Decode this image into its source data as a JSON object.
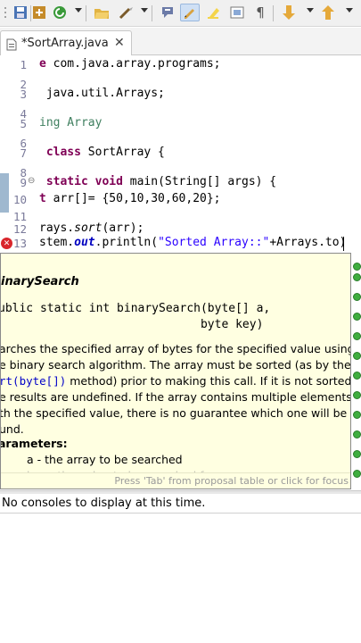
{
  "toolbar": {
    "icons": [
      "save-icon",
      "skip-breakpoints-icon",
      "debug-icon",
      "open-folder-icon",
      "wand-icon",
      "comment-icon",
      "edit-toggle-icon",
      "highlight-icon",
      "show-whitespace-icon",
      "next-annotation-icon",
      "previous-annotation-icon"
    ]
  },
  "editor_tab": {
    "label": "*SortArray.java",
    "close": "✕"
  },
  "code_lines": [
    {
      "num": "1",
      "text": "e com.java.array.programs;"
    },
    {
      "num": "2",
      "text": ""
    },
    {
      "num": "3",
      "text": " java.util.Arrays;"
    },
    {
      "num": "4",
      "text": ""
    },
    {
      "num": "5",
      "text": "ing Array"
    },
    {
      "num": "6",
      "text": ""
    },
    {
      "num": "7",
      "text": " class SortArray {"
    },
    {
      "num": "8",
      "text": ""
    },
    {
      "num": "9",
      "text": " static void main(String[] args) {"
    },
    {
      "num": "10",
      "text": "t arr[]= {50,10,30,60,20};"
    },
    {
      "num": "11",
      "text": ""
    },
    {
      "num": "12",
      "text": "rays.sort(arr);"
    },
    {
      "num": "13",
      "text": "stem.out.println(\"Sorted Array::\"+Arrays.to)"
    }
  ],
  "javadoc": {
    "title": "inarySearch",
    "signature_line1": "ublic static int binarySearch(byte[] a,",
    "signature_line2": "                             byte key)",
    "desc_part1": "arches the specified array of bytes for the specified value using e binary search algorithm. The array must be sorted (as by the ",
    "desc_link": "rt(byte[])",
    "desc_part2": " method) prior to making this call. If it is not sorted, e results are undefined. If the array contains multiple elements th the specified value, there is no guarantee which one will be und.",
    "params_heading": "arameters:",
    "param_a": "a - the array to be searched",
    "param_cut": "key - the value to be searched for",
    "status": "Press 'Tab' from proposal table or click for focus"
  },
  "console": {
    "message": "No consoles to display at this time."
  },
  "colors": {
    "keyword": "#7f0055",
    "string": "#2a00ff",
    "popup_bg": "#ffffe1",
    "error": "#d9262c"
  }
}
